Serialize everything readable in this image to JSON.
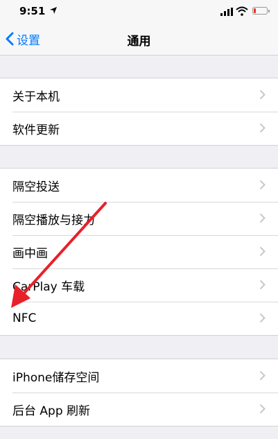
{
  "status_bar": {
    "time": "9:51",
    "icons": [
      "location-arrow-icon",
      "signal-icon",
      "wifi-icon",
      "battery-icon"
    ],
    "battery_level": 0.15,
    "battery_color": "#e0362c"
  },
  "nav": {
    "back_label": "设置",
    "title": "通用",
    "accent_color": "#007aff"
  },
  "groups": [
    {
      "items": [
        {
          "label": "关于本机"
        },
        {
          "label": "软件更新"
        }
      ]
    },
    {
      "items": [
        {
          "label": "隔空投送"
        },
        {
          "label": "隔空播放与接力"
        },
        {
          "label": "画中画"
        },
        {
          "label": "CarPlay 车载"
        },
        {
          "label": "NFC"
        }
      ]
    },
    {
      "items": [
        {
          "label": "iPhone储存空间"
        },
        {
          "label": "后台 App 刷新"
        }
      ]
    }
  ],
  "annotation": {
    "type": "arrow",
    "color": "#e8202a",
    "points_to": "NFC"
  }
}
